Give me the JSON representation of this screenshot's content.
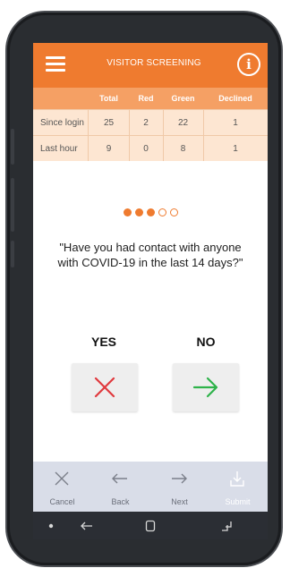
{
  "header": {
    "title": "VISITOR SCREENING",
    "info_glyph": "i",
    "icons": [
      "menu-icon",
      "info-icon"
    ],
    "accent_color": "#ef7b2f"
  },
  "stats": {
    "columns": [
      "",
      "Total",
      "Red",
      "Green",
      "Declined"
    ],
    "rows": [
      [
        "Since login",
        "25",
        "2",
        "22",
        "1"
      ],
      [
        "Last hour",
        "9",
        "0",
        "8",
        "1"
      ]
    ]
  },
  "progress": {
    "completed": 3,
    "total": 5
  },
  "question": "\"Have you had contact with anyone with COVID-19 in the last 14 days?\"",
  "answers": {
    "yes_label": "YES",
    "no_label": "NO",
    "yes_icon": "x-mark-icon",
    "no_icon": "arrow-right-icon",
    "yes_color": "#e0393e",
    "no_color": "#2eb34a"
  },
  "toolbar": {
    "cancel": "Cancel",
    "back": "Back",
    "next": "Next",
    "submit": "Submit"
  },
  "system_nav": [
    "dot-icon",
    "back-icon",
    "home-icon",
    "recents-icon"
  ]
}
